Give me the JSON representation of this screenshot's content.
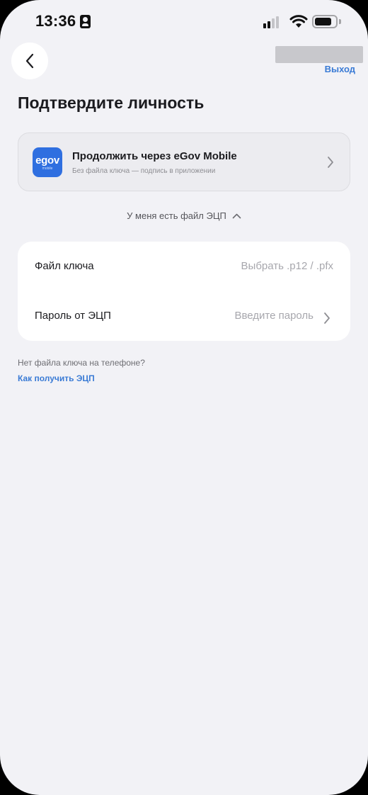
{
  "status_bar": {
    "time": "13:36"
  },
  "header": {
    "logout_label": "Выход"
  },
  "title": "Подтвердите личность",
  "egov_option": {
    "logo_text": "egov",
    "logo_subtext": "mobile",
    "title": "Продолжить через eGov Mobile",
    "subtitle": "Без файла ключа — подпись в приложении"
  },
  "ecp_toggle": {
    "label": "У меня есть файл ЭЦП",
    "expanded": true
  },
  "key_form": {
    "file_row": {
      "label": "Файл ключа",
      "value": "Выбрать .p12 / .pfx"
    },
    "password_row": {
      "label": "Пароль от ЭЦП",
      "placeholder": "Введите пароль"
    }
  },
  "footer": {
    "question": "Нет файла ключа на телефоне?",
    "link": "Как получить ЭЦП"
  },
  "colors": {
    "accent": "#3a7bd5",
    "egov_brand": "#2f6fe0",
    "background": "#f2f2f6"
  }
}
